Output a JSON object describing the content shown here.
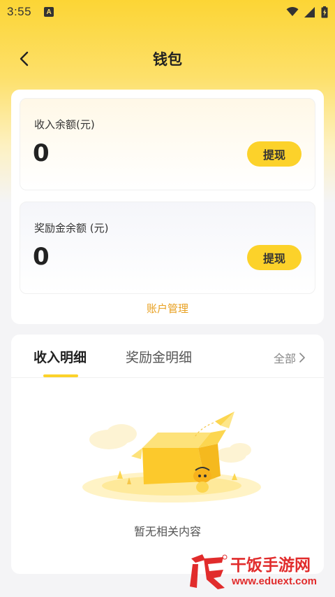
{
  "status_bar": {
    "time": "3:55",
    "notification_icon": "a-icon",
    "icons": [
      "wifi-icon",
      "signal-icon",
      "battery-icon"
    ]
  },
  "nav": {
    "back_icon": "chevron-left-icon",
    "title": "钱包"
  },
  "income_card": {
    "label": "收入余额(元)",
    "amount": "0",
    "withdraw_label": "提现"
  },
  "bonus_card": {
    "label": "奖励金余额 (元)",
    "amount": "0",
    "withdraw_label": "提现"
  },
  "account_management": "账户管理",
  "tabs": [
    {
      "label": "收入明细",
      "active": true
    },
    {
      "label": "奖励金明细",
      "active": false
    }
  ],
  "filter": {
    "label": "全部",
    "icon": "chevron-right-icon"
  },
  "empty_state": {
    "text": "暂无相关内容",
    "illustration": "empty-box-illustration"
  },
  "watermark": {
    "name": "干饭手游网",
    "url": "www.eduext.com"
  },
  "colors": {
    "accent_yellow": "#fcd22a",
    "link_orange": "#e8a020",
    "watermark_red": "#e12c2c"
  }
}
